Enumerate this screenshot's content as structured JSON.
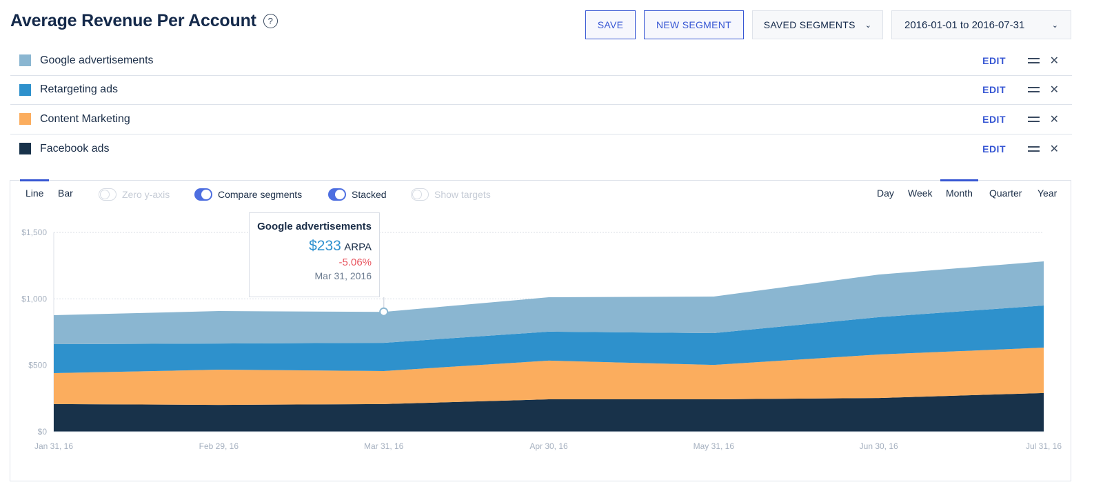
{
  "header": {
    "title": "Average Revenue Per Account",
    "help_icon": "question-circle-icon",
    "save_label": "SAVE",
    "new_segment_label": "NEW SEGMENT",
    "saved_segments_label": "SAVED SEGMENTS",
    "date_range": "2016-01-01 to 2016-07-31"
  },
  "segments": [
    {
      "label": "Google advertisements",
      "color": "#8ab6d1",
      "edit": "EDIT"
    },
    {
      "label": "Retargeting ads",
      "color": "#2e91cc",
      "edit": "EDIT"
    },
    {
      "label": "Content Marketing",
      "color": "#fbad5e",
      "edit": "EDIT"
    },
    {
      "label": "Facebook ads",
      "color": "#18324a",
      "edit": "EDIT"
    }
  ],
  "controls": {
    "chart_types": [
      "Line",
      "Bar"
    ],
    "active_chart_type": "Line",
    "toggles": [
      {
        "label": "Zero y-axis",
        "on": false
      },
      {
        "label": "Compare segments",
        "on": true
      },
      {
        "label": "Stacked",
        "on": true
      },
      {
        "label": "Show targets",
        "on": false
      }
    ],
    "periods": [
      "Day",
      "Week",
      "Month",
      "Quarter",
      "Year"
    ],
    "active_period": "Month"
  },
  "tooltip": {
    "title": "Google advertisements",
    "value": "$233",
    "unit": "ARPA",
    "change": "-5.06%",
    "date": "Mar 31, 2016"
  },
  "chart_data": {
    "type": "area",
    "stacked": true,
    "title": "Average Revenue Per Account",
    "xlabel": "",
    "ylabel": "",
    "categories": [
      "Jan 31, 16",
      "Feb 29, 16",
      "Mar 31, 16",
      "Apr 30, 16",
      "May 31, 16",
      "Jun 30, 16",
      "Jul 31, 16"
    ],
    "yticks": [
      "$0",
      "$500",
      "$1,000",
      "$1,500"
    ],
    "ytick_values": [
      0,
      500,
      1000,
      1500
    ],
    "ylim": [
      0,
      1500
    ],
    "grid": true,
    "series": [
      {
        "name": "Facebook ads",
        "color": "#18324a",
        "values": [
          208,
          202,
          208,
          244,
          244,
          254,
          291
        ]
      },
      {
        "name": "Content Marketing",
        "color": "#fbad5e",
        "values": [
          233,
          265,
          249,
          291,
          259,
          327,
          342
        ]
      },
      {
        "name": "Retargeting ads",
        "color": "#2e91cc",
        "values": [
          218,
          197,
          212,
          218,
          239,
          281,
          317
        ]
      },
      {
        "name": "Google advertisements",
        "color": "#8ab6d1",
        "values": [
          218,
          244,
          233,
          259,
          275,
          321,
          332
        ]
      }
    ],
    "highlight": {
      "series": "Google advertisements",
      "index": 2
    }
  }
}
